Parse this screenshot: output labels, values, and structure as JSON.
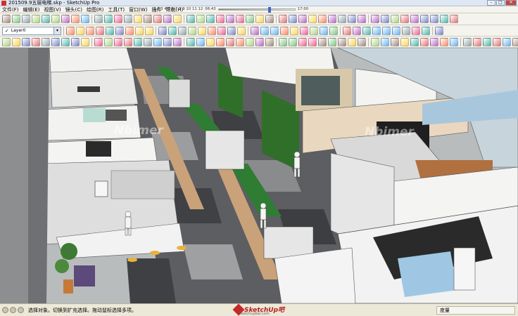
{
  "window": {
    "title": "201509.9五层电梯.skp - SketchUp Pro",
    "controls": [
      "–",
      "□",
      "✕"
    ]
  },
  "menu": {
    "items": [
      "文件(F)",
      "编辑(E)",
      "视图(V)",
      "镜头(C)",
      "绘图(R)",
      "工具(T)",
      "窗口(W)",
      "插件",
      "帮助(H)"
    ]
  },
  "shadow_slider": {
    "months": "1 2 3 4 5 6 7 8 9 10 11 12",
    "time_start": "06:43",
    "time_end": "17:00"
  },
  "layer": {
    "current": "Layer0",
    "check": "✓"
  },
  "viewport": {
    "watermarks": [
      "Nbimer",
      "Nbimer"
    ]
  },
  "status": {
    "text": "选择对象。切换到扩充选择。拖动鼠标选择多项。",
    "measure_label": "度量",
    "logo_name": "SketchUp吧",
    "logo_sub": "sketchupbar.com"
  },
  "colors": {
    "wall_white": "#f2f2f0",
    "floor_dark": "#3e3e40",
    "floor_mid": "#6b6b6e",
    "floor_light": "#9a9a9c",
    "wood_strip": "#c9a27a",
    "table_green": "#2e7d32",
    "green_wall": "#2f6f2a",
    "glass": "#a9c7dc",
    "accent_red": "#d32f2f"
  },
  "toolbar_icons": {
    "row1": [
      "file-icon",
      "open-icon",
      "save-icon",
      "cut-icon",
      "copy-icon",
      "paste-icon",
      "erase-icon",
      "undo-icon",
      "redo-icon",
      "print-icon",
      "model-info-icon",
      "select-icon",
      "make-component-icon",
      "paint-icon",
      "eraser-icon",
      "line-icon",
      "arc-icon",
      "rectangle-icon",
      "circle-icon",
      "polygon-icon",
      "freehand-icon",
      "move-icon",
      "push-pull-icon",
      "rotate-icon",
      "follow-me-icon",
      "scale-icon",
      "offset-icon",
      "tape-icon",
      "dimension-icon",
      "protractor-icon",
      "text-icon",
      "axes-icon",
      "3d-text-icon",
      "orbit-icon",
      "pan-icon",
      "zoom-icon",
      "zoom-window-icon",
      "zoom-extents-icon",
      "previous-icon",
      "next-icon",
      "position-camera-icon",
      "walk-icon",
      "look-around-icon",
      "section-plane-icon",
      "iso-icon",
      "top-icon",
      "front-icon",
      "right-icon",
      "back-icon",
      "left-icon",
      "xray-icon",
      "wireframe-icon",
      "hidden-line-icon",
      "shaded-icon",
      "textured-icon",
      "monochrome-icon",
      "sandbox-icon",
      "smoove-icon",
      "stamp-icon",
      "drape-icon",
      "add-detail-icon",
      "flip-edge-icon",
      "warehouse-icon",
      "share-icon",
      "extension-icon",
      "ruby-icon",
      "layers-icon",
      "outliner-icon",
      "scenes-icon",
      "styles-icon",
      "fog-icon",
      "match-photo-icon"
    ],
    "row2": [
      "cube-icon",
      "box-icon",
      "solid-union-icon",
      "solid-subtract-icon",
      "intersect-icon",
      "trim-icon",
      "split-icon",
      "outer-shell-icon",
      "array-icon",
      "align-icon",
      "mirror-icon",
      "group-icon",
      "explode-icon",
      "hide-icon",
      "unhide-icon",
      "lock-icon",
      "unlock-icon",
      "soften-icon",
      "smooth-icon",
      "weld-icon",
      "join-icon",
      "fillet-icon",
      "chamfer-icon",
      "extrude-icon",
      "loft-icon",
      "sweep-icon",
      "curviloft-icon",
      "joint-push-icon",
      "vertex-icon",
      "subdivide-icon",
      "crease-icon",
      "render-icon",
      "light-icon",
      "material-icon",
      "camera-icon",
      "export-icon",
      "import-icon",
      "layout-icon",
      "style-builder-icon",
      "section-fill-icon",
      "cleanup-icon",
      "purge-icon",
      "stats-icon",
      "dynamic-icon",
      "interact-icon",
      "attribute-icon",
      "report-icon",
      "tag-icon",
      "filter-icon",
      "measure-icon",
      "area-icon",
      "volume-icon",
      "angle-icon",
      "grid-icon",
      "snap-icon",
      "guide-icon",
      "point-icon",
      "ruler-icon",
      "compass-icon",
      "sun-icon",
      "shadow-icon",
      "north-icon",
      "geo-icon",
      "terrain-icon",
      "road-icon",
      "tree-icon",
      "person-icon",
      "car-icon",
      "window-icon",
      "door-icon",
      "stair-icon",
      "roof-icon",
      "wall-icon"
    ]
  }
}
